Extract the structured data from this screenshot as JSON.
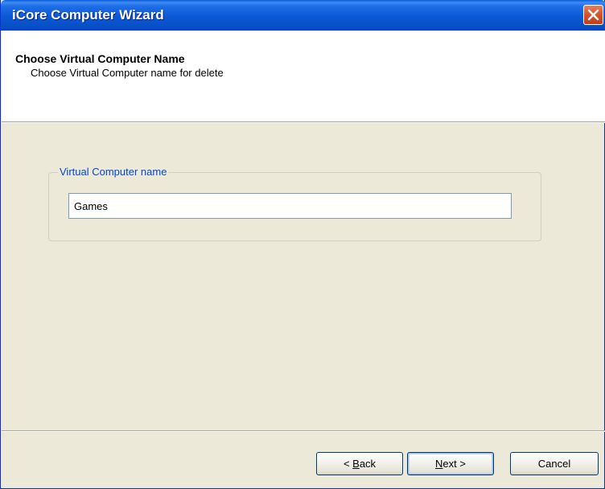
{
  "window": {
    "title": "iCore Computer Wizard"
  },
  "header": {
    "title": "Choose Virtual Computer Name",
    "subtitle": "Choose Virtual Computer name for delete"
  },
  "group": {
    "label": "Virtual Computer name",
    "input_value": "Games"
  },
  "buttons": {
    "back_prefix": "< ",
    "back_mnemonic": "B",
    "back_rest": "ack",
    "next_mnemonic": "N",
    "next_rest": "ext >",
    "cancel": "Cancel"
  },
  "colors": {
    "titlebar": "#0a58d6",
    "group_label": "#0046d5",
    "close_button": "#d9532c",
    "dialog_background": "#ece9d8"
  },
  "icons": {
    "close": "close-icon"
  }
}
